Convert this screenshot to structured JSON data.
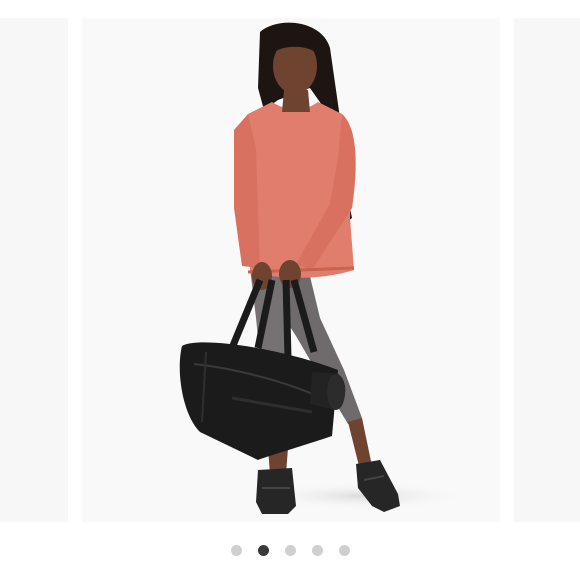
{
  "carousel": {
    "slide_count": 5,
    "active_index": 1,
    "current_slide": {
      "subject": "model-photo",
      "colors": {
        "sweatshirt": "#e07d6c",
        "leggings": "#6f6b6d",
        "bag": "#1b1b1b",
        "shoes": "#262626",
        "skin": "#6e4431",
        "hair": "#1c1512"
      }
    }
  }
}
